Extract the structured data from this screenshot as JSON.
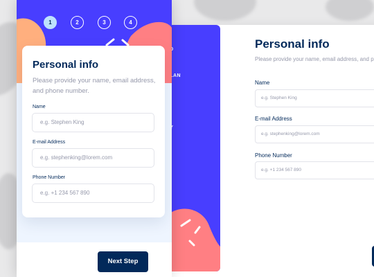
{
  "colors": {
    "accent": "#483eff",
    "dark_blue": "#02295a",
    "light_blue_active": "#bee2fd",
    "pink_shape": "#ff7f83",
    "orange_shape": "#ffaf7e",
    "gray_text": "#9699ab"
  },
  "mobile": {
    "steps": [
      {
        "number": "1",
        "active": true
      },
      {
        "number": "2",
        "active": false
      },
      {
        "number": "3",
        "active": false
      },
      {
        "number": "4",
        "active": false
      }
    ],
    "card": {
      "title": "Personal info",
      "subtitle": "Please provide your name, email address, and phone number.",
      "fields": [
        {
          "label": "Name",
          "placeholder": "e.g. Stephen King"
        },
        {
          "label": "E-mail Address",
          "placeholder": "e.g. stephenking@lorem.com"
        },
        {
          "label": "Phone Number",
          "placeholder": "e.g. +1 234 567 890"
        }
      ]
    },
    "next_button": "Next Step"
  },
  "desktop": {
    "sidebar_items": [
      "FO",
      "PLAN",
      "S",
      "RY"
    ],
    "title": "Personal info",
    "subtitle": "Please provide your name, email address, and phone number.",
    "fields": [
      {
        "label": "Name",
        "placeholder": "e.g. Stephen King"
      },
      {
        "label": "E-mail Address",
        "placeholder": "e.g. stephenking@lorem.com"
      },
      {
        "label": "Phone Number",
        "placeholder": "e.g. +1 234 567 890"
      }
    ]
  }
}
